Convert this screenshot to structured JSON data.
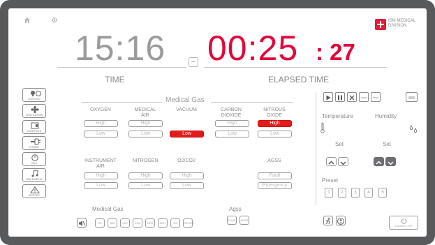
{
  "header": {
    "home_icon": "home-icon",
    "settings_icon": "gear-icon",
    "brand_line1": "ISM MEDICAL",
    "brand_line2": "DIVISION"
  },
  "clock": {
    "time": "15:16",
    "time_label": "TIME",
    "elapsed": "00:25",
    "elapsed_seconds": ": 27",
    "elapsed_label": "ELAPSED TIME",
    "reset_symbol": "–"
  },
  "nav": [
    {
      "label": "LIGHTING",
      "icon": "lighting-icon"
    },
    {
      "label": "VENTILATION",
      "icon": "fan-icon"
    },
    {
      "label": "CONTROLS",
      "icon": "controls-icon"
    },
    {
      "label": "POWER",
      "icon": "plug-icon"
    },
    {
      "label": "GAS",
      "icon": "gauge-icon"
    },
    {
      "label": "MULTIMEDIA",
      "icon": "music-icon"
    },
    {
      "label": "HISTORY",
      "icon": "warning-icon"
    }
  ],
  "gas": {
    "title": "Medical Gas",
    "row1": [
      {
        "name": "OXYGEN",
        "high": "High",
        "low": "Low",
        "alarm": ""
      },
      {
        "name": "MEDICAL\nAIR",
        "high": "High",
        "low": "Low",
        "alarm": ""
      },
      {
        "name": "VACUUM",
        "high": "",
        "low": "Low",
        "alarm": "low"
      },
      {
        "name": "CARBON\nDIOXIDE",
        "high": "High",
        "low": "Low",
        "alarm": ""
      },
      {
        "name": "NITROUS\nOXIDE",
        "high": "High",
        "low": "Low",
        "alarm": "high"
      }
    ],
    "row2": [
      {
        "name": "INSTRUMENT\nAIR",
        "high": "High",
        "low": "Low"
      },
      {
        "name": "NITROGEN",
        "high": "High",
        "low": "Low"
      },
      {
        "name": "O2/CO2",
        "high": "High",
        "low": "Low"
      }
    ],
    "agss": {
      "name": "AGSS",
      "fault": "Fault",
      "emergency": "Emergency"
    }
  },
  "climate": {
    "temperature_label": "Temperature",
    "humidity_label": "Humidity",
    "set_label": "Set",
    "preset_label": "Preset",
    "presets": [
      "1",
      "2",
      "3",
      "4",
      "5"
    ]
  },
  "bottom": {
    "gas_label": "Medical Gas",
    "gas_buttons": [
      "O2",
      "AIR",
      "VAC",
      "CO2",
      "N2O",
      "AIR7",
      "N2",
      "O2/CO2"
    ],
    "agss_label": "Agss",
    "agss_buttons": [
      "FLAIR",
      "AGSS"
    ],
    "power_label": "STANDBY / OFF"
  },
  "colors": {
    "accent": "#e2073b",
    "alarm": "#e21c1c",
    "bezel": "#58595b"
  }
}
